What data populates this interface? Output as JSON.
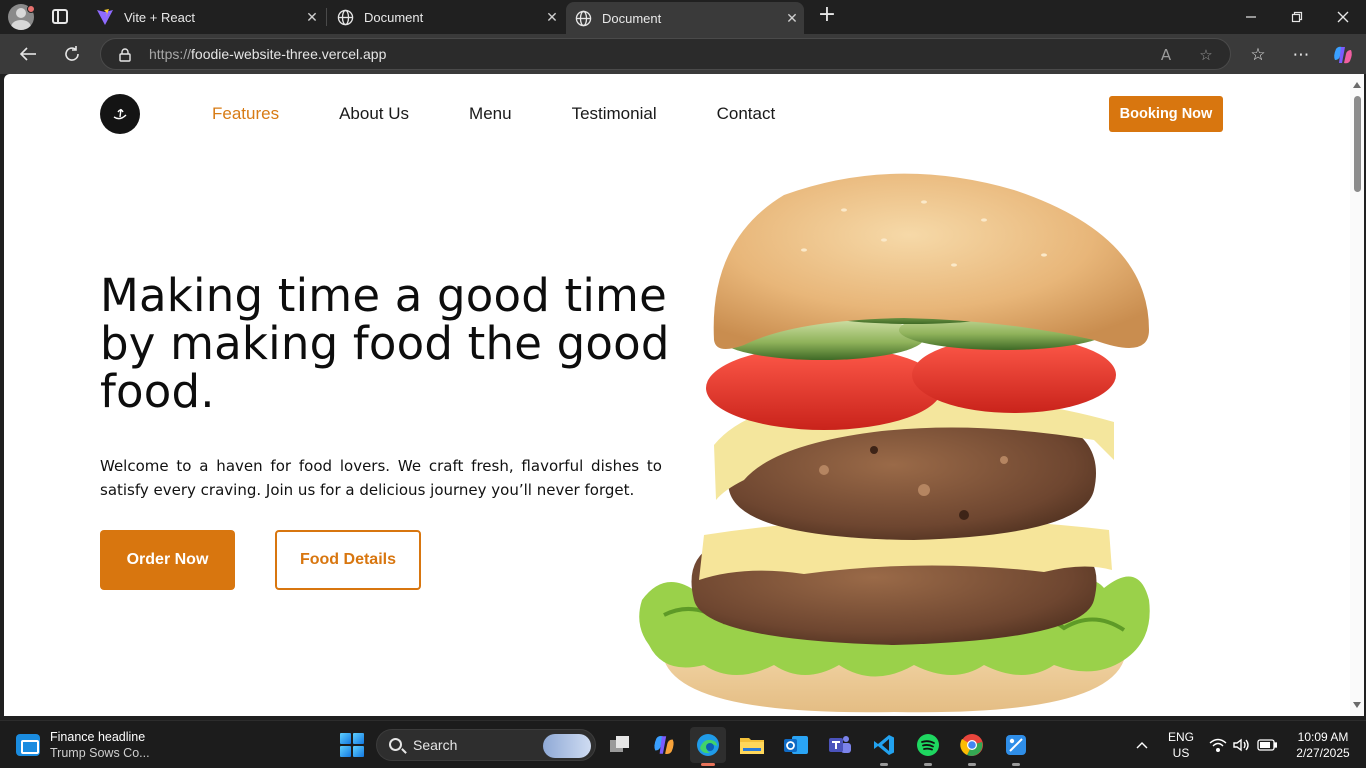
{
  "browser": {
    "tabs": [
      {
        "title": "Vite + React",
        "favicon": "vite-icon"
      },
      {
        "title": "Document",
        "favicon": "globe-icon"
      },
      {
        "title": "Document",
        "favicon": "globe-icon",
        "active": true
      }
    ],
    "url_protocol": "https://",
    "url_host": "foodie-website-three.vercel.app"
  },
  "site": {
    "nav": [
      "Features",
      "About Us",
      "Menu",
      "Testimonial",
      "Contact"
    ],
    "active_nav": "Features",
    "booking_label": "Booking Now",
    "hero_title": "Making time a good time by making food the good food.",
    "hero_text": "Welcome to a haven for food lovers. We craft fresh, flavorful dishes to satisfy every craving. Join us for a delicious journey you’ll never forget.",
    "order_label": "Order Now",
    "details_label": "Food Details",
    "accent_color": "#d8760f"
  },
  "taskbar": {
    "widget_title": "Finance headline",
    "widget_sub": "Trump Sows Co...",
    "search_label": "Search",
    "lang_line1": "ENG",
    "lang_line2": "US",
    "time": "10:09 AM",
    "date": "2/27/2025"
  }
}
